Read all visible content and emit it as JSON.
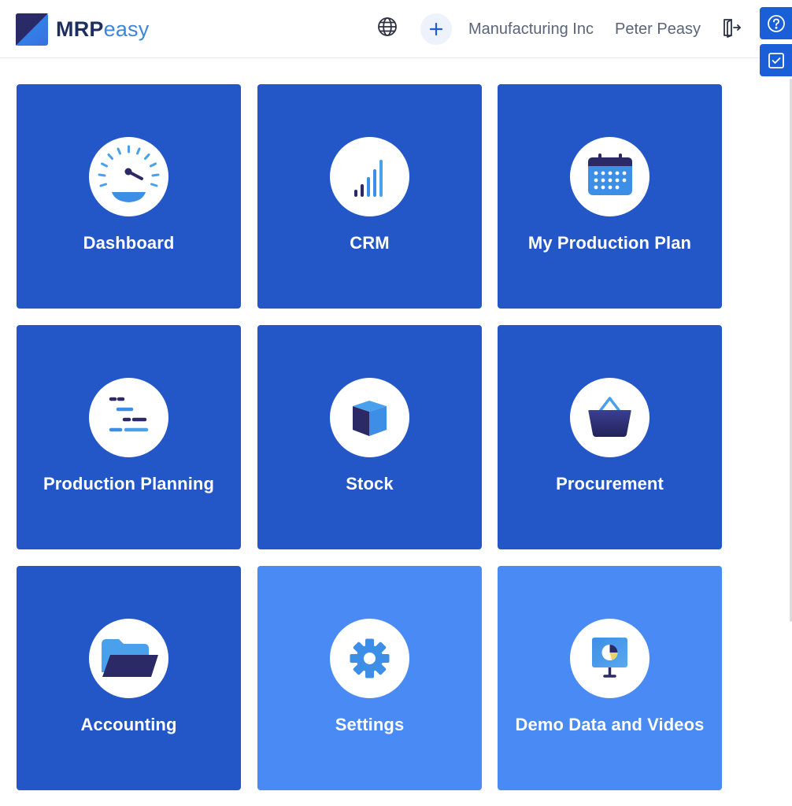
{
  "header": {
    "logo_mrp": "MRP",
    "logo_easy": "easy",
    "company": "Manufacturing Inc",
    "user": "Peter Peasy"
  },
  "icons": {
    "language": "globe-icon",
    "add": "plus-icon",
    "logout": "logout-icon",
    "help": "help-circle-icon",
    "tasks": "checkbox-icon"
  },
  "colors": {
    "tile_dark": "#2356c7",
    "tile_light": "#4a8af4",
    "brand_navy": "#1d2f5e",
    "brand_blue": "#3e86d8",
    "side_button": "#1a5fd8"
  },
  "tiles": [
    {
      "label": "Dashboard",
      "icon": "speedometer-icon"
    },
    {
      "label": "CRM",
      "icon": "signal-bars-icon"
    },
    {
      "label": "My Production Plan",
      "icon": "calendar-icon"
    },
    {
      "label": "Production Planning",
      "icon": "gantt-icon"
    },
    {
      "label": "Stock",
      "icon": "box-icon"
    },
    {
      "label": "Procurement",
      "icon": "basket-icon"
    },
    {
      "label": "Accounting",
      "icon": "folder-icon"
    },
    {
      "label": "Settings",
      "icon": "gear-icon"
    },
    {
      "label": "Demo Data and Videos",
      "icon": "presentation-icon"
    }
  ]
}
